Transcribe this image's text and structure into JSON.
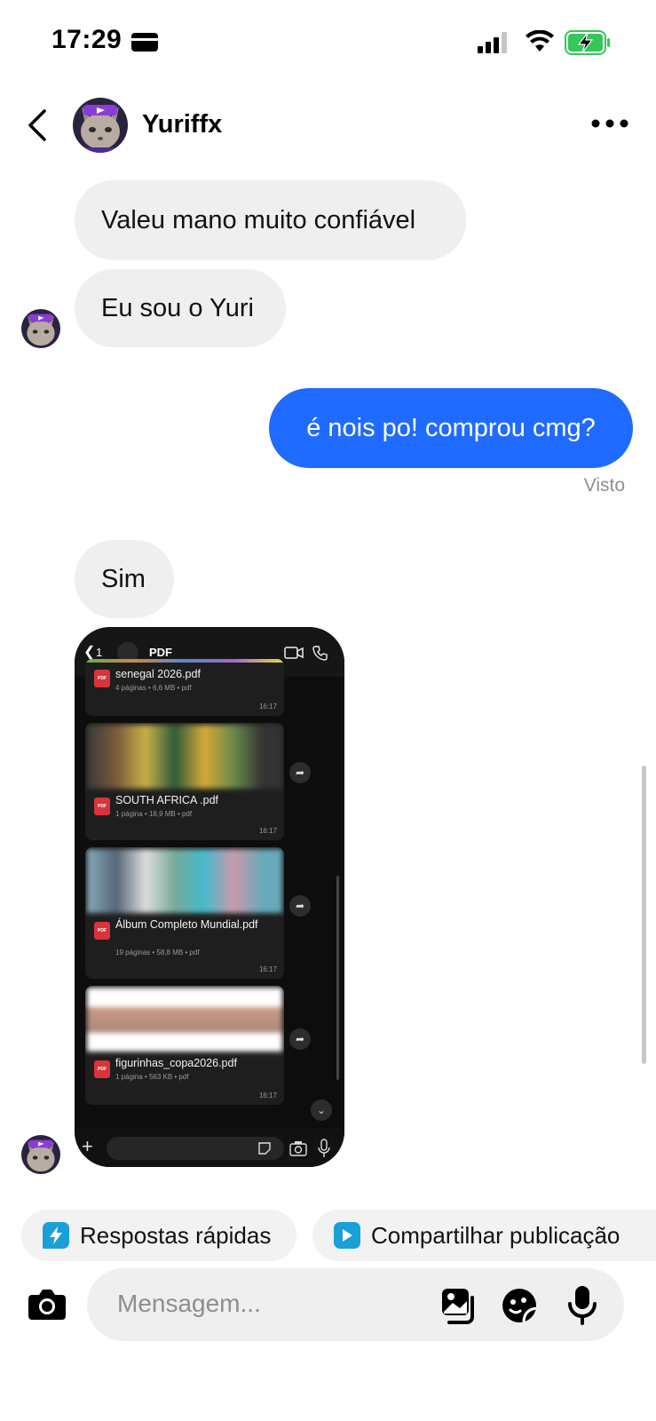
{
  "status_bar": {
    "time": "17:29"
  },
  "header": {
    "contact_name": "Yuriffx"
  },
  "messages": {
    "m1": "Valeu mano muito confiável",
    "m2": "Eu sou o Yuri",
    "m3": "é nois po! comprou cmg?",
    "seen": "Visto",
    "m4": "Sim"
  },
  "shared_screenshot": {
    "back_count": "1",
    "title": "PDF",
    "docs": [
      {
        "name": "senegal 2026.pdf",
        "meta": "4 páginas • 6,6 MB • pdf",
        "time": "16:17"
      },
      {
        "name": "SOUTH AFRICA .pdf",
        "meta": "1 página • 18,9 MB • pdf",
        "time": "16:17"
      },
      {
        "name": "Álbum Completo Mundial.pdf",
        "meta": "19 páginas • 58,8 MB • pdf",
        "time": "16:17"
      },
      {
        "name": "figurinhas_copa2026.pdf",
        "meta": "1 página • 563 KB • pdf",
        "time": "16:17"
      }
    ],
    "pdf_badge": "PDF"
  },
  "quick_actions": {
    "quick_replies": "Respostas rápidas",
    "share_post": "Compartilhar publicação"
  },
  "composer": {
    "placeholder": "Mensagem..."
  },
  "colors": {
    "outgoing_bubble": "#1f6bff",
    "incoming_bubble": "#efefef",
    "quick_icon": "#1aa0d6"
  }
}
